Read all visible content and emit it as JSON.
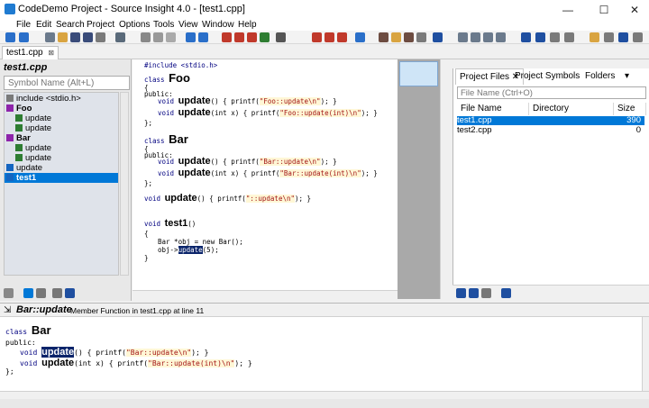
{
  "window": {
    "title": "CodeDemo Project - Source Insight 4.0 - [test1.cpp]",
    "controls": [
      "—",
      "☐",
      "✕"
    ]
  },
  "menu": [
    "File",
    "Edit",
    "Search",
    "Project",
    "Options",
    "Tools",
    "View",
    "Window",
    "Help"
  ],
  "tabs": {
    "active": "test1.cpp",
    "close": "⊠"
  },
  "symbol_panel": {
    "file": "test1.cpp",
    "search_placeholder": "Symbol Name (Alt+L)",
    "items": [
      {
        "label": "include <stdio.h>",
        "indent": 0,
        "icon": "include"
      },
      {
        "label": "Foo",
        "indent": 0,
        "icon": "class"
      },
      {
        "label": "update",
        "indent": 1,
        "icon": "method"
      },
      {
        "label": "update",
        "indent": 1,
        "icon": "method"
      },
      {
        "label": "Bar",
        "indent": 0,
        "icon": "class"
      },
      {
        "label": "update",
        "indent": 1,
        "icon": "method"
      },
      {
        "label": "update",
        "indent": 1,
        "icon": "method"
      },
      {
        "label": "update",
        "indent": 0,
        "icon": "function"
      },
      {
        "label": "test1",
        "indent": 0,
        "icon": "function",
        "selected": true
      }
    ]
  },
  "editor": {
    "lines": {
      "l1": "#include <stdio.h>",
      "foo_kw": "class ",
      "foo_name": "Foo",
      "brace_open": "{",
      "public": "public:",
      "void_kw": "void ",
      "upd": "update",
      "paren_void": "() { printf(",
      "foo_str1": "\"Foo::update\\n\"",
      "end_stmt": "); }",
      "int_param": "(int x) { printf(",
      "foo_str2": "\"Foo::update(int)\\n\"",
      "brace_close": "};",
      "bar_name": "Bar",
      "bar_str1": "\"Bar::update\\n\"",
      "bar_str2": "\"Bar::update(int)\\n\"",
      "global_str": "\"::update\\n\"",
      "test1": "test1",
      "empty_parens": "()",
      "open": "{",
      "obj_decl": "Bar *obj = new Bar();",
      "obj_call": "obj->",
      "call_args": "(5);",
      "close": "}"
    }
  },
  "project_panel": {
    "tabs": [
      "Project Files ✕",
      "Project Symbols",
      "Folders",
      "▾"
    ],
    "filter_placeholder": "File Name (Ctrl+O)",
    "columns": [
      "File Name",
      "Directory",
      "Size"
    ],
    "rows": [
      {
        "name": "test1.cpp",
        "dir": "",
        "size": "390",
        "selected": true
      },
      {
        "name": "test2.cpp",
        "dir": "",
        "size": "0",
        "selected": false
      }
    ]
  },
  "context": {
    "symbol": "Bar::update",
    "desc": "Member Function in test1.cpp at line 11",
    "pin_icon": "⇲"
  },
  "colors": {
    "accent": "#0078d7",
    "keyword": "#000080",
    "string": "#a31515"
  }
}
